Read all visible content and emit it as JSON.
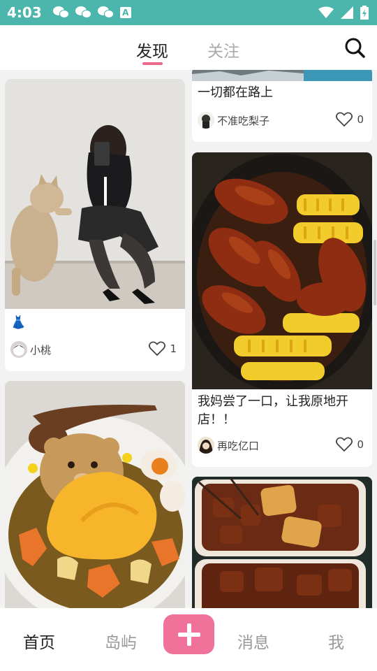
{
  "status_bar": {
    "time": "4:03",
    "icons": [
      "wechat-icon",
      "wechat-icon",
      "wechat-icon",
      "a-icon",
      "wifi-icon",
      "signal-icon",
      "battery-icon"
    ]
  },
  "top_nav": {
    "tabs": [
      {
        "label": "发现",
        "active": true
      },
      {
        "label": "关注",
        "active": false
      }
    ],
    "accent_color": "#ec6b8d",
    "search_icon": "search-icon"
  },
  "feed": {
    "left_column": [
      {
        "title": "👗",
        "author": "小桃",
        "likes": "1"
      },
      {
        "title": "",
        "author": "",
        "likes": ""
      }
    ],
    "right_column": [
      {
        "title": "一切都在路上",
        "author": "不准吃梨子",
        "likes": "0"
      },
      {
        "title": "我妈尝了一口，让我原地开店！！",
        "author": "再吃亿口",
        "likes": "0"
      },
      {
        "title": "",
        "author": "",
        "likes": ""
      }
    ]
  },
  "bottom_nav": {
    "items": [
      {
        "label": "首页",
        "active": true
      },
      {
        "label": "岛屿",
        "active": false
      },
      {
        "label": "+",
        "active": false
      },
      {
        "label": "消息",
        "active": false
      },
      {
        "label": "我",
        "active": false
      }
    ],
    "add_color": "#f0719a"
  }
}
